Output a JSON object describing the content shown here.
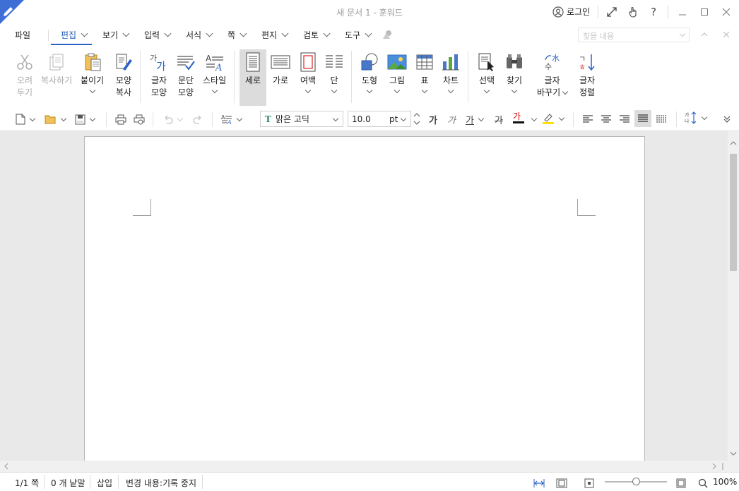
{
  "window": {
    "title": "새 문서 1 - 훈워드",
    "login_label": "로그인"
  },
  "menu": {
    "items": [
      "파일",
      "편집",
      "보기",
      "입력",
      "서식",
      "쪽",
      "편지",
      "검토",
      "도구"
    ],
    "active": "편집",
    "search_placeholder": "찾을 내용"
  },
  "ribbon": {
    "cut": [
      "오려",
      "두기"
    ],
    "copy": "복사하기",
    "paste": "붙이기",
    "format_copy": [
      "모양",
      "복사"
    ],
    "char_shape": [
      "글자",
      "모양"
    ],
    "para_shape": [
      "문단",
      "모양"
    ],
    "style": "스타일",
    "portrait": "세로",
    "landscape": "가로",
    "margin": "여백",
    "columns": "단",
    "shape": "도형",
    "picture": "그림",
    "table": "표",
    "chart": "차트",
    "select": "선택",
    "find": "찾기",
    "replace": [
      "글자",
      "바꾸기"
    ],
    "sort": [
      "글자",
      "정렬"
    ]
  },
  "toolbar": {
    "font_name": "맑은 고딕",
    "font_size": "10.0",
    "font_unit": "pt",
    "bold_glyph": "가",
    "italic_glyph": "가",
    "underline_glyph": "가",
    "strike_glyph": "가",
    "color_glyph": "가",
    "style_glyph": "가",
    "colors": {
      "font_color": "#cc0000",
      "highlight": "#ffe000",
      "accent": "#2a62c9"
    }
  },
  "status": {
    "page": "1/1 쪽",
    "words": "0 개 낱말",
    "mode": "삽입",
    "track": "변경 내용:기록 중지",
    "zoom": "100%",
    "zoom_value": 100
  }
}
